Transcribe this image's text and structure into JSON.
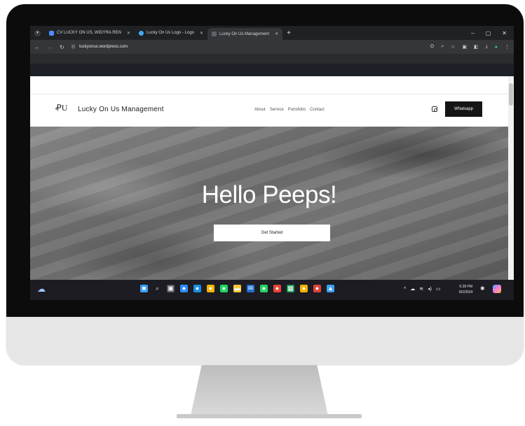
{
  "browser": {
    "tabs": [
      {
        "title": "CV LUCKY ON US, WIDYRA REN",
        "icon": "shield-icon",
        "color": "#4e8cff"
      },
      {
        "title": "Lucky On Us Logo - Logo",
        "icon": "globe-icon",
        "color": "#3fa9f5"
      },
      {
        "title": "Lucky On Us Management",
        "icon": "page-icon",
        "color": "#35363a"
      }
    ],
    "new_tab": "+",
    "url": "luckyonus.wordpress.com",
    "window_controls": [
      "–",
      "▢",
      "✕"
    ]
  },
  "site": {
    "logo_text": "ꝒU",
    "brand": "Lucky On Us Management",
    "nav": [
      "About",
      "Service",
      "Portofolio",
      "Contact"
    ],
    "cta": "Whatsapp",
    "hero_title": "Hello Peeps!",
    "hero_button": "Get Started"
  },
  "taskbar": {
    "clock_time": "6:28 PM",
    "clock_date": "8/2/2024",
    "icons": [
      {
        "name": "start-icon",
        "color": "#3aa0ff",
        "glyph": "■"
      },
      {
        "name": "search-icon",
        "color": "transparent",
        "glyph": "⌕"
      },
      {
        "name": "task-view-icon",
        "color": "#5a5a66",
        "glyph": "▣"
      },
      {
        "name": "zoom-icon",
        "color": "#2d8cff",
        "glyph": "●"
      },
      {
        "name": "edge-icon",
        "color": "#1a8fe0",
        "glyph": "●"
      },
      {
        "name": "chrome-icon",
        "color": "#f2b705",
        "glyph": "●"
      },
      {
        "name": "spotify-icon",
        "color": "#1ed760",
        "glyph": "●"
      },
      {
        "name": "files-icon",
        "color": "#ffc83d",
        "glyph": "▬"
      },
      {
        "name": "mail-icon",
        "color": "#1f6fd1",
        "glyph": "✉"
      },
      {
        "name": "whatsapp-icon",
        "color": "#25d366",
        "glyph": "●"
      },
      {
        "name": "chrome-profile-icon",
        "color": "#e94235",
        "glyph": "●"
      },
      {
        "name": "sheets-icon",
        "color": "#1e9e56",
        "glyph": "▦"
      },
      {
        "name": "chrome-profile-2-icon",
        "color": "#f4b400",
        "glyph": "●"
      },
      {
        "name": "chrome-profile-3-icon",
        "color": "#db4437",
        "glyph": "●"
      },
      {
        "name": "photos-icon",
        "color": "#3ba1f2",
        "glyph": "▲"
      }
    ]
  }
}
